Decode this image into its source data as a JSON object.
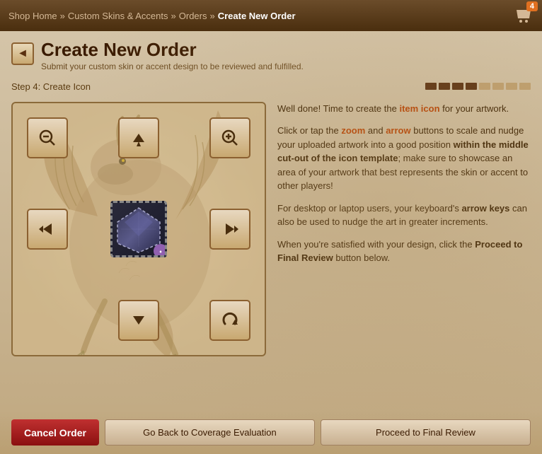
{
  "nav": {
    "shop_home": "Shop Home",
    "separator1": "»",
    "custom_skins": "Custom Skins & Accents",
    "separator2": "»",
    "orders": "Orders",
    "separator3": "»",
    "current": "Create New Order",
    "cart_count": "4"
  },
  "header": {
    "title": "Create New Order",
    "subtitle": "Submit your custom skin or accent design to be reviewed and fulfilled.",
    "back_label": "◄"
  },
  "step": {
    "label": "Step 4: Create Icon",
    "dots": [
      {
        "active": true
      },
      {
        "active": true
      },
      {
        "active": true
      },
      {
        "active": true
      },
      {
        "active": false
      },
      {
        "active": false
      },
      {
        "active": false
      },
      {
        "active": false
      }
    ]
  },
  "instructions": {
    "p1_pre": "Well done! Time to create the ",
    "p1_bold": "item icon",
    "p1_post": " for your artwork.",
    "p2_pre": "Click or tap the ",
    "p2_zoom": "zoom",
    "p2_mid": " and ",
    "p2_arrow": "arrow",
    "p2_post": " buttons to scale and nudge your uploaded artwork into a good position ",
    "p2_bold": "within the middle cut-out of the icon template",
    "p2_post2": "; make sure to showcase an area of your artwork that best represents the skin or accent to other players!",
    "p3": "For desktop or laptop users, your keyboard's arrow keys can also be used to nudge the art in greater increments.",
    "p4_pre": "When you're satisfied with your design, click the ",
    "p4_bold": "Proceed to Final Review",
    "p4_post": " button below."
  },
  "buttons": {
    "cancel": "Cancel Order",
    "back": "Go Back to Coverage Evaluation",
    "proceed": "Proceed to Final Review"
  },
  "controls": {
    "zoom_out": "−",
    "zoom_in": "+",
    "up": "▲▲",
    "left": "◀◀",
    "right": "▶▶",
    "down": "▼▼",
    "rotate": "↺"
  }
}
